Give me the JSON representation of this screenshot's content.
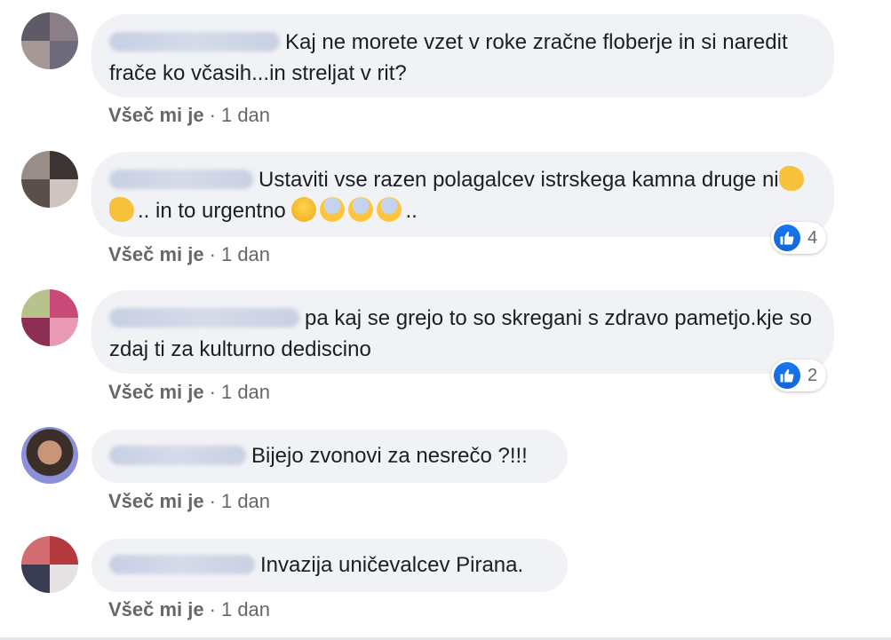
{
  "comments": [
    {
      "text": "Kaj ne morete vzet v roke zračne floberje in si naredit frače ko včasih...in streljat v rit?",
      "like_label": "Všeč mi je",
      "separator": "·",
      "time": "1 dan",
      "reaction_count": null
    },
    {
      "text_before": "Ustaviti vse razen polagalcev istrskega kamna druge ni",
      "text_after": ".. in to urgentno",
      "text_end": "..",
      "like_label": "Všeč mi je",
      "separator": "·",
      "time": "1 dan",
      "reaction_count": "4"
    },
    {
      "text": "pa kaj se grejo to so skregani s zdravo pametjo.kje so zdaj ti za kulturno dediscino",
      "like_label": "Všeč mi je",
      "separator": "·",
      "time": "1 dan",
      "reaction_count": "2"
    },
    {
      "text": "Bijejo zvonovi za nesrečo ?!!!",
      "like_label": "Všeč mi je",
      "separator": "·",
      "time": "1 dan",
      "reaction_count": null
    },
    {
      "text": "Invazija uničevalcev Pirana.",
      "like_label": "Všeč mi je",
      "separator": "·",
      "time": "1 dan",
      "reaction_count": null
    }
  ],
  "colors": {
    "bubble": "#f0f2f5",
    "text": "#1c1e21",
    "meta": "#65676b",
    "like_blue": "#1877f2"
  }
}
